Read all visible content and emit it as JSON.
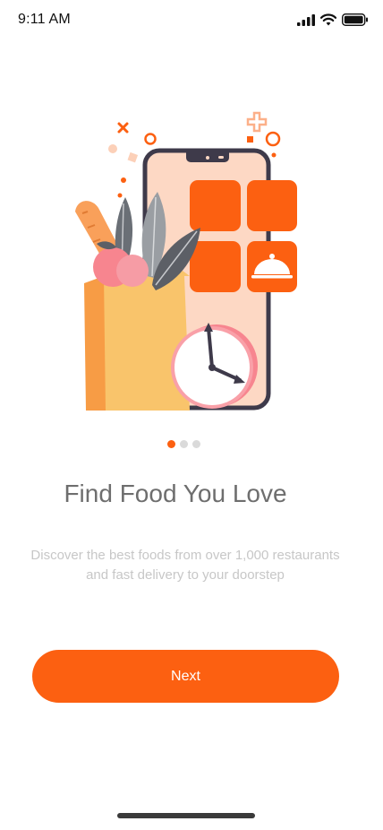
{
  "status_bar": {
    "time": "9:11 AM"
  },
  "onboarding": {
    "illustration_icon": "food-delivery-illustration",
    "page_index": 1,
    "page_count": 3,
    "title": "Find Food You Love",
    "description": "Discover the best foods from over 1,000 restaurants and fast delivery to your doorstep",
    "next_label": "Next"
  },
  "colors": {
    "accent": "#FC6011",
    "title_text": "#6E6E6E",
    "description_text": "#C7C7C7",
    "dot_inactive": "#DADADA"
  }
}
